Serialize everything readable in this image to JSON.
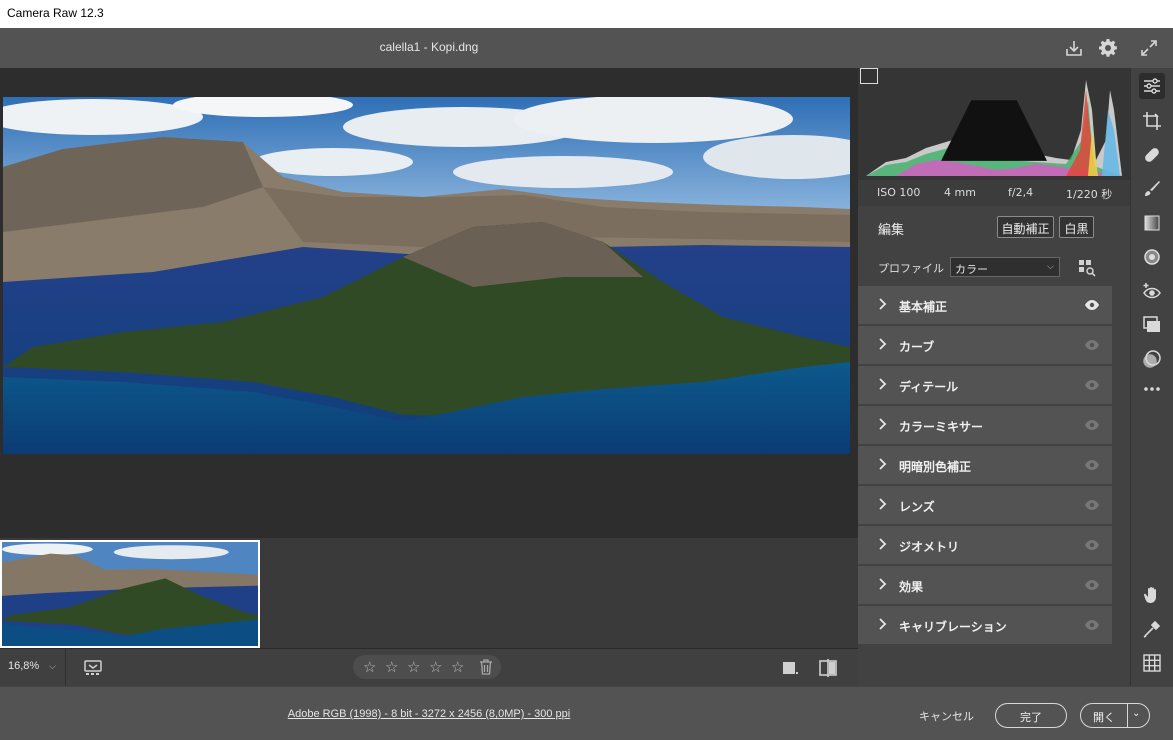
{
  "window": {
    "title": "Camera Raw 12.3"
  },
  "header": {
    "filename": "calella1 - Kopi.dng",
    "icons": [
      "save-icon",
      "gear-icon",
      "fullscreen-icon"
    ]
  },
  "histogram": {
    "exif": {
      "iso": "ISO 100",
      "focal": "4 mm",
      "aperture": "f/2,4",
      "shutter": "1/220 秒"
    }
  },
  "edit": {
    "title": "編集",
    "auto_label": "自動補正",
    "bw_label": "白黒",
    "profile_label": "プロファイル",
    "profile_value": "カラー"
  },
  "sections": [
    {
      "label": "基本補正",
      "visible": true
    },
    {
      "label": "カーブ",
      "visible": false
    },
    {
      "label": "ディテール",
      "visible": false
    },
    {
      "label": "カラーミキサー",
      "visible": false
    },
    {
      "label": "明暗別色補正",
      "visible": false
    },
    {
      "label": "レンズ",
      "visible": false
    },
    {
      "label": "ジオメトリ",
      "visible": false
    },
    {
      "label": "効果",
      "visible": false
    },
    {
      "label": "キャリブレーション",
      "visible": false
    }
  ],
  "bottombar": {
    "zoom": "16,8%",
    "rating_stars": 5
  },
  "statusbar": {
    "workflow": "Adobe RGB (1998) - 8 bit - 3272 x 2456 (8,0MP) - 300 ppi",
    "cancel_label": "キャンセル",
    "done_label": "完了",
    "open_label": "開く"
  },
  "tools": [
    "edit-sliders-icon",
    "crop-icon",
    "healing-icon",
    "brush-icon",
    "gradient-icon",
    "radial-icon",
    "redeye-icon",
    "snapshots-icon",
    "presets-icon",
    "more-icon",
    "hand-icon",
    "sampler-icon",
    "grid-icon"
  ],
  "colors": {
    "accent_red": "#e04a3a",
    "panel_bg": "#424242",
    "section_bg": "#535353"
  }
}
